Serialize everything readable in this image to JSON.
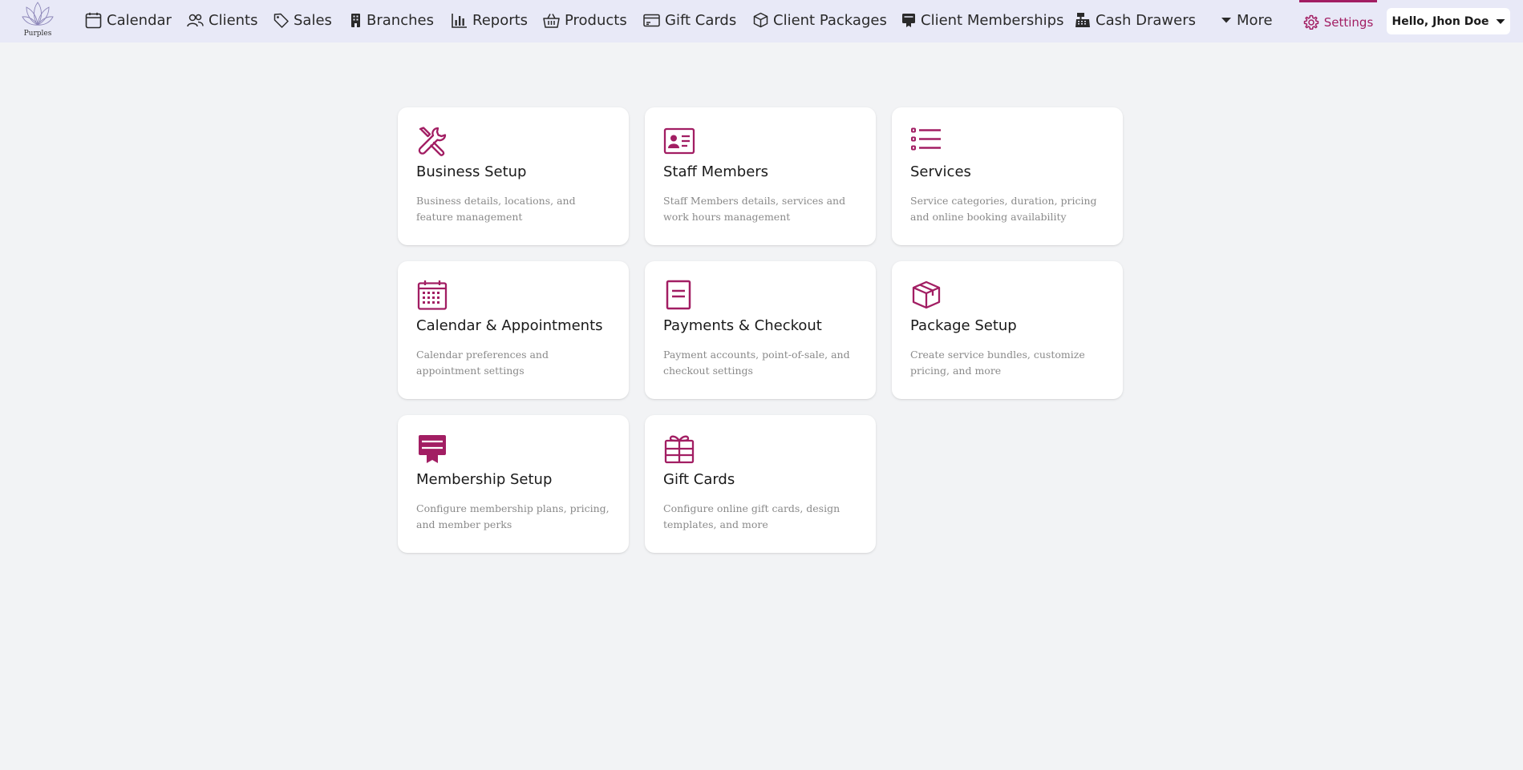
{
  "app": {
    "logo_text": "Purples",
    "accent_color": "#a21e63"
  },
  "nav": {
    "items": [
      {
        "label": "Calendar",
        "icon": "calendar-icon"
      },
      {
        "label": "Clients",
        "icon": "users-icon"
      },
      {
        "label": "Sales",
        "icon": "tag-icon"
      },
      {
        "label": "Branches",
        "icon": "building-icon"
      },
      {
        "label": "Reports",
        "icon": "bar-chart-icon"
      },
      {
        "label": "Products",
        "icon": "basket-icon"
      },
      {
        "label": "Gift Cards",
        "icon": "gift-card-icon"
      },
      {
        "label": "Client Packages",
        "icon": "box-icon"
      },
      {
        "label": "Client Memberships",
        "icon": "membership-icon"
      },
      {
        "label": "Cash Drawers",
        "icon": "cash-register-icon"
      },
      {
        "label": "More",
        "icon": "caret-down-icon"
      }
    ],
    "settings_label": "Settings",
    "user_label": "Hello, Jhon Doe"
  },
  "cards": [
    {
      "title": "Business Setup",
      "description": "Business details, locations, and feature management",
      "icon": "tools-icon"
    },
    {
      "title": "Staff Members",
      "description": "Staff Members details, services and work hours management",
      "icon": "id-card-icon"
    },
    {
      "title": "Services",
      "description": "Service categories, duration, pricing and online booking availability",
      "icon": "list-icon"
    },
    {
      "title": "Calendar & Appointments",
      "description": "Calendar preferences and appointment settings",
      "icon": "calendar-grid-icon"
    },
    {
      "title": "Payments & Checkout",
      "description": "Payment accounts, point-of-sale, and checkout settings",
      "icon": "receipt-icon"
    },
    {
      "title": "Package Setup",
      "description": "Create service bundles, customize pricing, and more",
      "icon": "package-icon"
    },
    {
      "title": "Membership Setup",
      "description": "Configure membership plans, pricing, and member perks",
      "icon": "membership-card-icon"
    },
    {
      "title": "Gift Cards",
      "description": "Configure online gift cards, design templates, and more",
      "icon": "gift-icon"
    }
  ]
}
